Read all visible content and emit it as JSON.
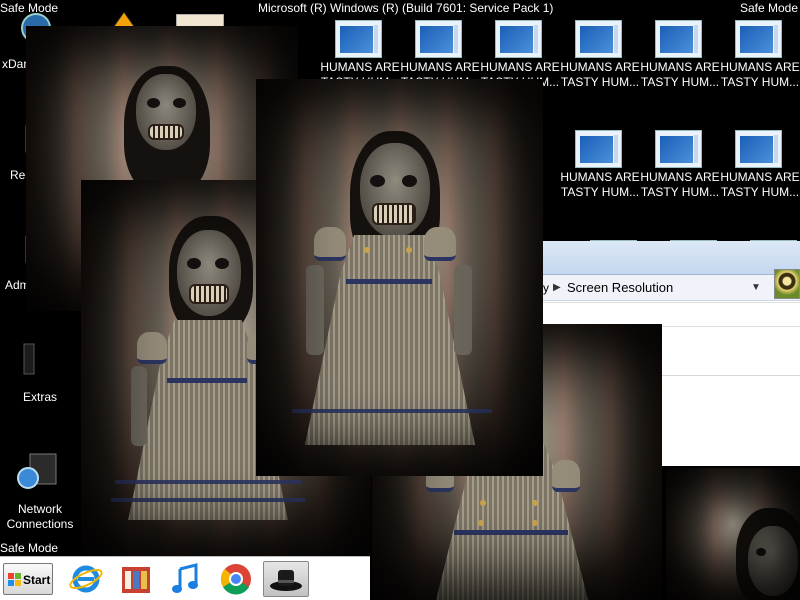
{
  "screen": {
    "watermark_top_left": "Safe Mode",
    "watermark_top_right": "Safe Mode",
    "watermark_bottom_left": "Safe Mode",
    "build_text": "Microsoft (R) Windows (R) (Build 7601: Service Pack 1)"
  },
  "desktop_icons": [
    {
      "name": "xdark-icon",
      "label": "xDar"
    },
    {
      "name": "recycle-bin-icon",
      "label": "Rec"
    },
    {
      "name": "admin-icon",
      "label": "Adm"
    },
    {
      "name": "extras-icon",
      "label": "Extras"
    },
    {
      "name": "network-connections-icon",
      "label": "Network Connections"
    }
  ],
  "tiles": {
    "label_line1": "HUMANS ARE",
    "label_line2": "TASTY HUM...",
    "partial_left": "m...",
    "partial_row2": "...",
    "partial_row2b": "..."
  },
  "window": {
    "breadcrumb_prev": "y",
    "breadcrumb_current": "Screen Resolution"
  },
  "taskbar": {
    "start_label": "Start",
    "apps": [
      "internet-explorer-icon",
      "library-icon",
      "music-icon",
      "chrome-icon",
      "hat-icon"
    ]
  },
  "colors": {
    "desktop": "#000000",
    "taskbar": "#ffffff",
    "sash": "#2c3560",
    "flag_blue": "#1a5fb8"
  }
}
